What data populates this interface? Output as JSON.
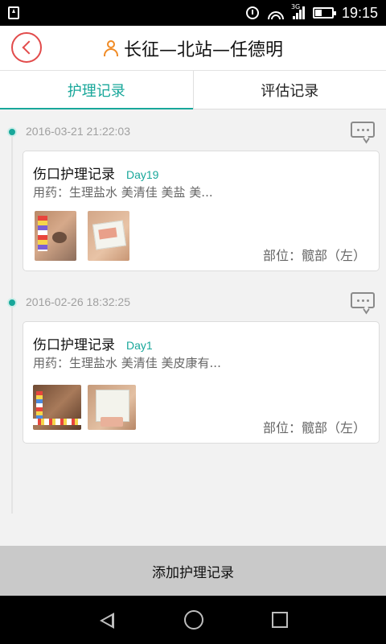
{
  "status_bar": {
    "time": "19:15",
    "network_label": "3G",
    "icons": [
      "notification-icon",
      "alarm-icon",
      "wifi-icon",
      "signal-icon",
      "battery-icon"
    ]
  },
  "header": {
    "title": "长征—北站—任德明",
    "back_icon": "chevron-left-icon",
    "person_icon": "person-icon",
    "accent_back": "#e24b4b",
    "accent_person": "#f08a24"
  },
  "tabs": [
    {
      "label": "护理记录",
      "active": true
    },
    {
      "label": "评估记录",
      "active": false
    }
  ],
  "theme": {
    "accent": "#18a79a"
  },
  "records": [
    {
      "time": "2016-03-21 21:22:03",
      "title": "伤口护理记录",
      "day": "Day19",
      "meds": "用药：生理盐水 美清佳 美盐 美...",
      "site": "部位：髋部（左）",
      "photos": [
        "wound-photo",
        "dressing-photo"
      ]
    },
    {
      "time": "2016-02-26 18:32:25",
      "title": "伤口护理记录",
      "day": "Day1",
      "meds": "用药：生理盐水 美清佳 美皮康有...",
      "site": "部位：髋部（左）",
      "photos": [
        "wound-photo",
        "dressing-photo"
      ]
    }
  ],
  "add_button": {
    "label": "添加护理记录"
  },
  "nav_bar": {
    "icons": [
      "nav-back-icon",
      "nav-home-icon",
      "nav-recent-icon"
    ]
  }
}
